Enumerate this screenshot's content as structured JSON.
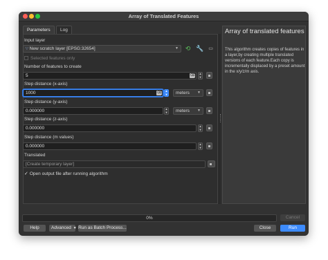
{
  "window": {
    "title": "Array of Translated Features"
  },
  "tabs": [
    {
      "label": "Parameters"
    },
    {
      "label": "Log"
    }
  ],
  "params": {
    "input_layer": {
      "label": "Input layer",
      "value": "New scratch layer [EPSG:32654]",
      "selected_only_label": "Selected features only"
    },
    "num_features": {
      "label": "Number of features to create",
      "value": "5"
    },
    "step_x": {
      "label": "Step distance (x-axis)",
      "value": "1000",
      "unit": "meters"
    },
    "step_y": {
      "label": "Step distance (y-axis)",
      "value": "0.000000",
      "unit": "meters"
    },
    "step_z": {
      "label": "Step distance (z-axis)",
      "value": "0.000000"
    },
    "step_m": {
      "label": "Step distance (m values)",
      "value": "0.000000"
    },
    "translated": {
      "label": "Translated",
      "placeholder": "[Create temporary layer]"
    },
    "open_output": {
      "label": "Open output file after running algorithm",
      "checked": true
    }
  },
  "help": {
    "title": "Array of translated features",
    "body": "This algorithm creates copies of features in a layer,by creating multiple translated versions of each feature.Each copy is incrementally displaced by a preset amount in the x/y/z/m axis."
  },
  "progress": {
    "text": "0%",
    "value": 0
  },
  "buttons": {
    "cancel": "Cancel",
    "help": "Help",
    "advanced": "Advanced",
    "batch": "Run as Batch Process...",
    "close": "Close",
    "run": "Run"
  },
  "colors": {
    "accent": "#3d8bfd",
    "window_bg": "#323232",
    "panel_bg": "#2e2e2e"
  },
  "icons": [
    "point-layer-icon",
    "iterate-icon",
    "wrench-icon",
    "select-on-canvas-icon",
    "clear-icon",
    "data-defined-icon",
    "spinner-icon"
  ]
}
